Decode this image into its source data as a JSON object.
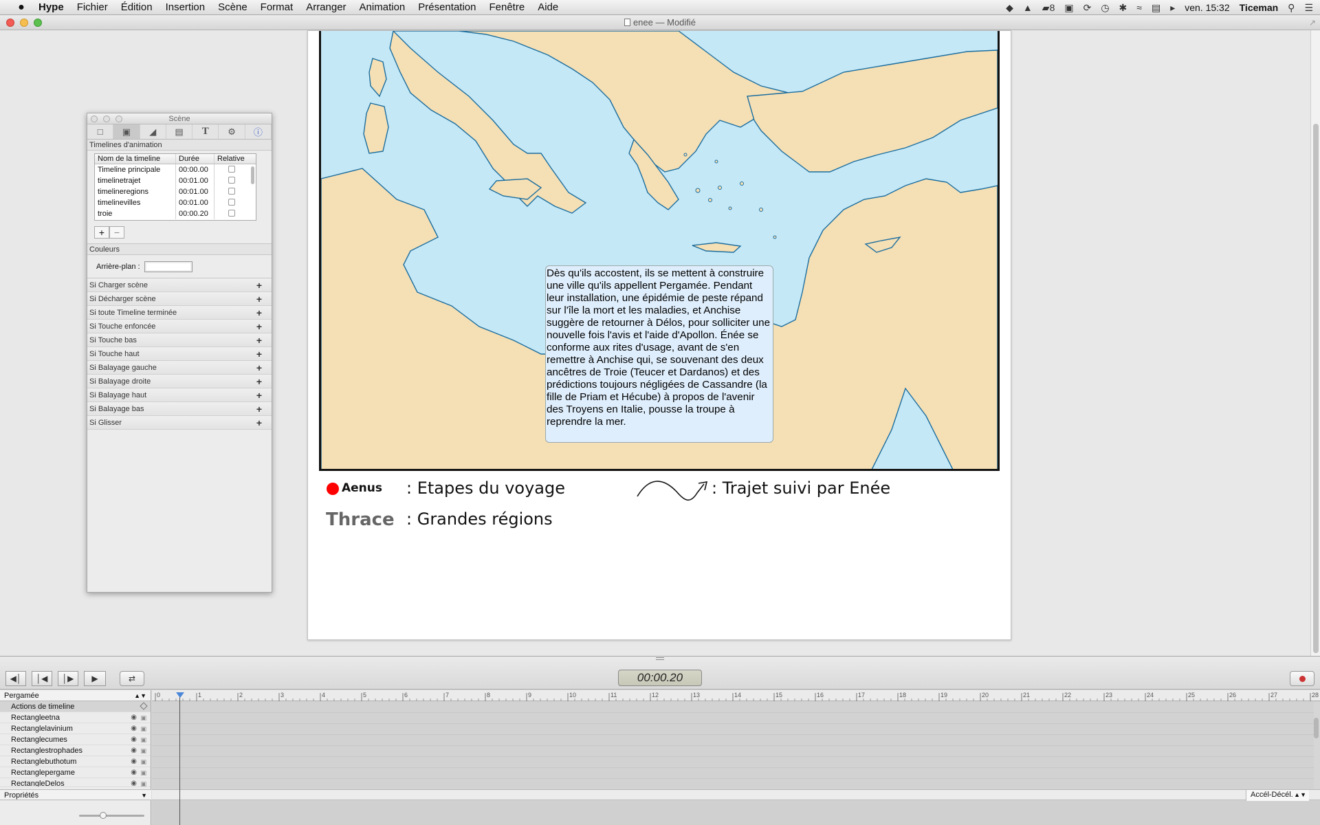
{
  "menubar": {
    "apple": "",
    "items": [
      "Hype",
      "Fichier",
      "Édition",
      "Insertion",
      "Scène",
      "Format",
      "Arranger",
      "Animation",
      "Présentation",
      "Fenêtre",
      "Aide"
    ],
    "status_count": "8",
    "clock": "ven. 15:32",
    "user": "Ticeman",
    "status_icons": [
      "dropbox-icon",
      "drive-icon",
      "adobe-icon",
      "airplay-icon",
      "sync-icon",
      "time-machine-icon",
      "bluetooth-icon",
      "wifi-icon",
      "keyboard-icon",
      "volume-icon",
      "search-icon",
      "list-icon"
    ]
  },
  "window": {
    "doc_name": "enee",
    "doc_state": "— Modifié"
  },
  "scene_panel": {
    "title": "Scène",
    "timelines_header": "Timelines d'animation",
    "columns": [
      "Nom de la timeline",
      "Durée",
      "Relative"
    ],
    "timelines": [
      {
        "name": "Timeline principale",
        "duration": "00:00.00"
      },
      {
        "name": "timelinetrajet",
        "duration": "00:01.00"
      },
      {
        "name": "timelineregions",
        "duration": "00:01.00"
      },
      {
        "name": "timelinevilles",
        "duration": "00:01.00"
      },
      {
        "name": "troie",
        "duration": "00:00.20"
      }
    ],
    "add_label": "+",
    "remove_label": "−",
    "colors_header": "Couleurs",
    "background_label": "Arrière-plan :",
    "events": [
      "Si Charger scène",
      "Si Décharger scène",
      "Si toute Timeline terminée",
      "Si Touche enfoncée",
      "Si Touche bas",
      "Si Touche haut",
      "Si Balayage gauche",
      "Si Balayage droite",
      "Si Balayage haut",
      "Si Balayage bas",
      "Si Glisser"
    ],
    "event_plus": "+"
  },
  "canvas": {
    "story_text": "Dès qu'ils accostent, ils se mettent à construire une ville qu'ils appellent Pergamée. Pendant leur installation, une épidémie de peste répand sur l'île la mort et les maladies, et Anchise suggère de retourner à Délos, pour solliciter une nouvelle fois l'avis et l'aide d'Apollon. Énée se conforme aux rites d'usage, avant de s'en remettre à Anchise qui, se souvenant des deux ancêtres de Troie (Teucer et Dardanos) et des prédictions toujours négligées de Cassandre (la fille de Priam et Hécube) à propos de l'avenir des Troyens en Italie, pousse la troupe à reprendre la mer.",
    "legend": {
      "city_sample": "Aenus",
      "city_desc": ": Etapes du voyage",
      "route_desc": ": Trajet suivi par Enée",
      "region_sample": "Thrace",
      "region_desc": ": Grandes régions"
    },
    "colors": {
      "sea": "#c5e8f6",
      "land": "#f5dfb5",
      "coast": "#1a6d9e",
      "dot": "#ff0000"
    }
  },
  "timeline": {
    "time": "00:00.20",
    "scene": "Pergamée",
    "actions_row": "Actions de timeline",
    "layers": [
      "Rectangleetna",
      "Rectanglelavinium",
      "Rectanglecumes",
      "Rectanglestrophades",
      "Rectanglebuthotum",
      "Rectanglepergame",
      "RectangleDelos"
    ],
    "properties": "Propriétés",
    "easing": "Accél-Décél.",
    "ruler": [
      "0",
      "1",
      "2",
      "3",
      "4",
      "5",
      "6",
      "7",
      "8",
      "9",
      "10",
      "11",
      "12",
      "13",
      "14",
      "15",
      "16",
      "17",
      "18",
      "19",
      "20",
      "21",
      "22",
      "23",
      "24",
      "25",
      "26",
      "27",
      "28"
    ]
  }
}
